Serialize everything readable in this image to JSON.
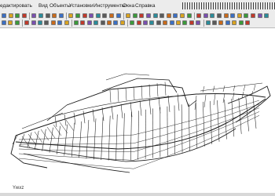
{
  "menu": {
    "items": [
      {
        "id": "edit",
        "label": "едактировать"
      },
      {
        "id": "view",
        "label": "Вид"
      },
      {
        "id": "objects",
        "label": "Объекты"
      },
      {
        "id": "settings",
        "label": "Установки"
      },
      {
        "id": "tools",
        "label": "Инструменты"
      },
      {
        "id": "window",
        "label": "Окна"
      },
      {
        "id": "help",
        "label": "Справка"
      }
    ]
  },
  "toolbars": {
    "row1_icons": [
      "new-icon",
      "open-icon",
      "save-icon",
      "print-icon",
      "cut-icon",
      "copy-icon",
      "paste-icon",
      "undo-icon",
      "redo-icon",
      "hand-icon",
      "zoom-in-icon",
      "zoom-out-icon",
      "zoom-window-icon",
      "zoom-all-icon",
      "zoom-prev-icon",
      "rotate-icon",
      "pan-icon",
      "line-icon",
      "circle-icon",
      "arc-icon",
      "point-icon",
      "measure-icon",
      "layer-icon",
      "color-icon",
      "grid-icon",
      "snap-icon",
      "ortho-icon",
      "view-front-icon",
      "view-side-icon",
      "view-top-icon",
      "view-iso-icon",
      "render-icon",
      "shade-icon",
      "wire-icon",
      "hide-icon",
      "select-icon",
      "properties-icon",
      "run-icon"
    ],
    "row2_icons": [
      "new-icon",
      "open-icon",
      "save-icon",
      "layer-icon",
      "copy-icon",
      "move-icon",
      "rotate-icon",
      "mirror-icon",
      "scale-icon",
      "array-icon",
      "trim-icon",
      "extend-icon",
      "offset-icon",
      "fillet-icon",
      "chamfer-icon",
      "break-icon",
      "join-icon",
      "explode-icon",
      "surface-icon",
      "solid-icon",
      "extrude-icon",
      "revolve-icon",
      "sweep-icon",
      "loft-icon",
      "section-icon",
      "slice-icon",
      "union-icon",
      "subtract-icon",
      "intersect-icon",
      "dimension-icon",
      "text-icon",
      "hatch-icon",
      "block-icon",
      "insert-icon",
      "attribute-icon",
      "run-icon"
    ]
  },
  "viewport": {
    "axis_label": "Y",
    "axis_sub": "ʍxz",
    "model_description_icon": "ship-hull-wireframe-model"
  },
  "colors": {
    "background": "#ffffff",
    "chrome": "#ececec",
    "wire": "#1a1a1a"
  }
}
